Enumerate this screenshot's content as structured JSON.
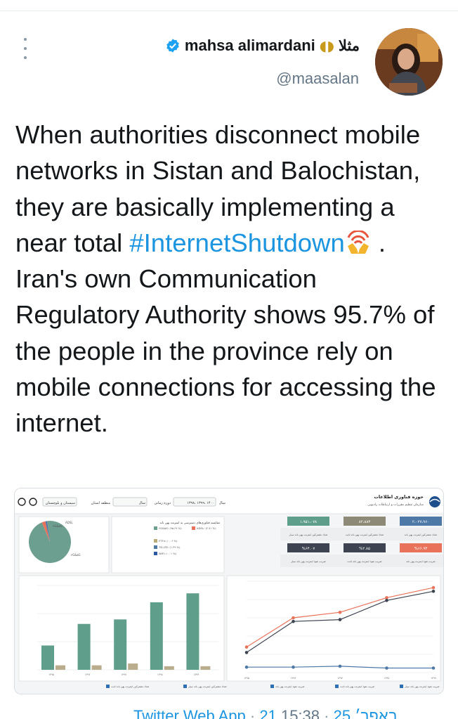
{
  "user": {
    "display_name": "mahsa alimardani",
    "rtl_name": "مثلا",
    "handle": "@maasalan",
    "verified_icon": "verified-badge-icon",
    "moon_icon": "moon-icon"
  },
  "tweet": {
    "text_before": "When authorities disconnect mobile networks in Sistan and Balochistan, they are basically implementing a near total",
    "hashtag": "#InternetShutdown",
    "text_after": ". Iran's own Communication Regulatory Authority shows 95.7% of the people in the province rely on mobile connections for accessing the internet.",
    "emoji": "wireless-hands-emoji"
  },
  "media": {
    "header_title": "حوزه فناوری اطلاعات",
    "header_subtitle": "سازمان تنظیم مقررات و ارتباطات رادیویی",
    "filter_province_label": "منطقه استان",
    "filter_province_value": "سیستان و بلوچستان",
    "filter_period_label": "دوره زمانی",
    "filter_period_value": "سال",
    "filter_year_label": "سال",
    "filter_year_value": "۱۳۹۸، ۱۳۹۹، ۱۴۰۰",
    "kpi_top": [
      {
        "value": "۲،۰۲۷،۹۶۰",
        "label": "تعداد مشترکین اینترنت پهن باند",
        "color": "#4e79a7"
      },
      {
        "value": "۸۲،۸۸۳",
        "label": "تعداد مشترکین اینترنت پهن باند ثابت",
        "color": "#8d8a77"
      },
      {
        "value": "۱،۹۵۱،۰۷۸",
        "label": "تعداد مشترکین اینترنت پهن باند سیار",
        "color": "#5f9e8a"
      }
    ],
    "kpi_bottom": [
      {
        "value": "%۶۶.۹۳",
        "label": "ضریب نفوذ اینترنت پهن باند",
        "color": "#e8735a"
      },
      {
        "value": "%۲.۸۵",
        "label": "ضریب نفوذ اینترنت پهن باند ثابت",
        "color": "#3d4350"
      },
      {
        "value": "%۶۴.۰۷",
        "label": "ضریب نفوذ اینترنت پهن باند سیار",
        "color": "#3d4350"
      }
    ],
    "pie_title": "مقایسه فناوری‌های دسترسی به اینترنت پهن باند",
    "pie_legend": [
      {
        "label": "۴G&۵G: (۹۵.۶۹ %)",
        "color": "#6d9f90"
      },
      {
        "label": "ADSL: (۲.۷۱ %)",
        "color": "#e8735a"
      },
      {
        "label": "FTTx: (۰.۰۶ %)",
        "color": "#b8ad7a"
      },
      {
        "label": "TD-LTE: (۱.۴۹ %)",
        "color": "#4e79a7"
      },
      {
        "label": "WiFi: (۰.۰۱ %)",
        "color": "#2c5aa0"
      }
    ],
    "pie_labels": {
      "big": "۴G&۵G",
      "small": "ADSL"
    },
    "bar_years": [
      "۱۳۹۵",
      "۱۳۹۶",
      "۱۳۹۷",
      "۱۳۹۸",
      "۱۳۹۹"
    ],
    "bar_legend": [
      "تعداد مشترکین اینترنت پهن باند سیار",
      "تعداد مشترکین اینترنت پهن باند ثابت"
    ],
    "line_years": [
      "۱۳۹۵",
      "۱۳۹۶",
      "۱۳۹۷",
      "۱۳۹۸",
      "۱۳۹۹"
    ],
    "line_legend": [
      "ضریب نفوذ اینترنت پهن باند سیار",
      "ضریب نفوذ اینترنت پهن باند ثابت",
      "ضریب نفوذ اینترنت پهن باند"
    ]
  },
  "footer": {
    "source": "Twitter Web App",
    "date": "21 באפר׳ 25",
    "time": "15:38"
  },
  "chart_data": {
    "type": "bar",
    "categories": [
      "۱۳۹۵",
      "۱۳۹۶",
      "۱۳۹۷",
      "۱۳۹۸",
      "۱۳۹۹"
    ],
    "series": [
      {
        "name": "تعداد مشترکین اینترنت پهن باند سیار",
        "values": [
          0.27,
          0.51,
          0.56,
          0.75,
          0.85
        ],
        "color": "#5f9e8a"
      },
      {
        "name": "تعداد مشترکین اینترنت پهن باند ثابت",
        "values": [
          0.05,
          0.05,
          0.07,
          0.04,
          0.04
        ],
        "color": "#b9ad8e"
      }
    ],
    "line_series": [
      {
        "values": [
          0.28,
          0.6,
          0.66,
          0.82,
          0.93
        ],
        "color": "#e8735a"
      },
      {
        "values": [
          0.22,
          0.56,
          0.58,
          0.79,
          0.89
        ],
        "color": "#3d4350"
      },
      {
        "values": [
          0.06,
          0.06,
          0.07,
          0.05,
          0.05
        ],
        "color": "#4e79a7"
      }
    ],
    "pie": [
      {
        "label": "۴G&۵G",
        "value": 95.69,
        "color": "#6d9f90"
      },
      {
        "label": "ADSL",
        "value": 2.71,
        "color": "#e8735a"
      },
      {
        "label": "TD-LTE",
        "value": 1.49,
        "color": "#4e79a7"
      },
      {
        "label": "FTTx",
        "value": 0.06,
        "color": "#b8ad7a"
      },
      {
        "label": "WiFi",
        "value": 0.01,
        "color": "#2c5aa0"
      }
    ]
  }
}
